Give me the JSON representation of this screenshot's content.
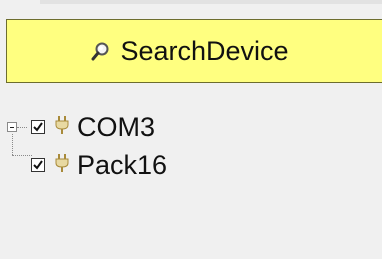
{
  "toolbar": {
    "search_label": "SearchDevice",
    "search_icon": "magnifier-icon",
    "button_color": "#ffff80"
  },
  "tree": {
    "nodes": [
      {
        "label": "COM3",
        "checked": true,
        "expanded": true,
        "icon": "plug-icon"
      },
      {
        "label": "Pack16",
        "checked": true,
        "icon": "plug-icon"
      }
    ]
  }
}
